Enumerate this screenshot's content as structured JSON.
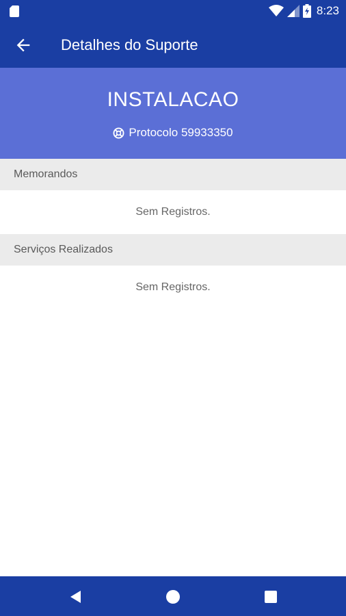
{
  "status_bar": {
    "time": "8:23"
  },
  "app_bar": {
    "title": "Detalhes do Suporte"
  },
  "header": {
    "title": "INSTALACAO",
    "protocol_label": "Protocolo 59933350"
  },
  "sections": [
    {
      "title": "Memorandos",
      "empty_text": "Sem Registros."
    },
    {
      "title": "Serviços Realizados",
      "empty_text": "Sem Registros."
    }
  ],
  "colors": {
    "primary": "#1a3ea3",
    "header_bg": "#5b6fd6",
    "section_bg": "#ebebeb"
  },
  "icons": [
    "sd-card-icon",
    "wifi-icon",
    "signal-icon",
    "battery-icon",
    "back-arrow-icon",
    "lifebuoy-icon",
    "nav-back-icon",
    "nav-home-icon",
    "nav-recents-icon"
  ]
}
